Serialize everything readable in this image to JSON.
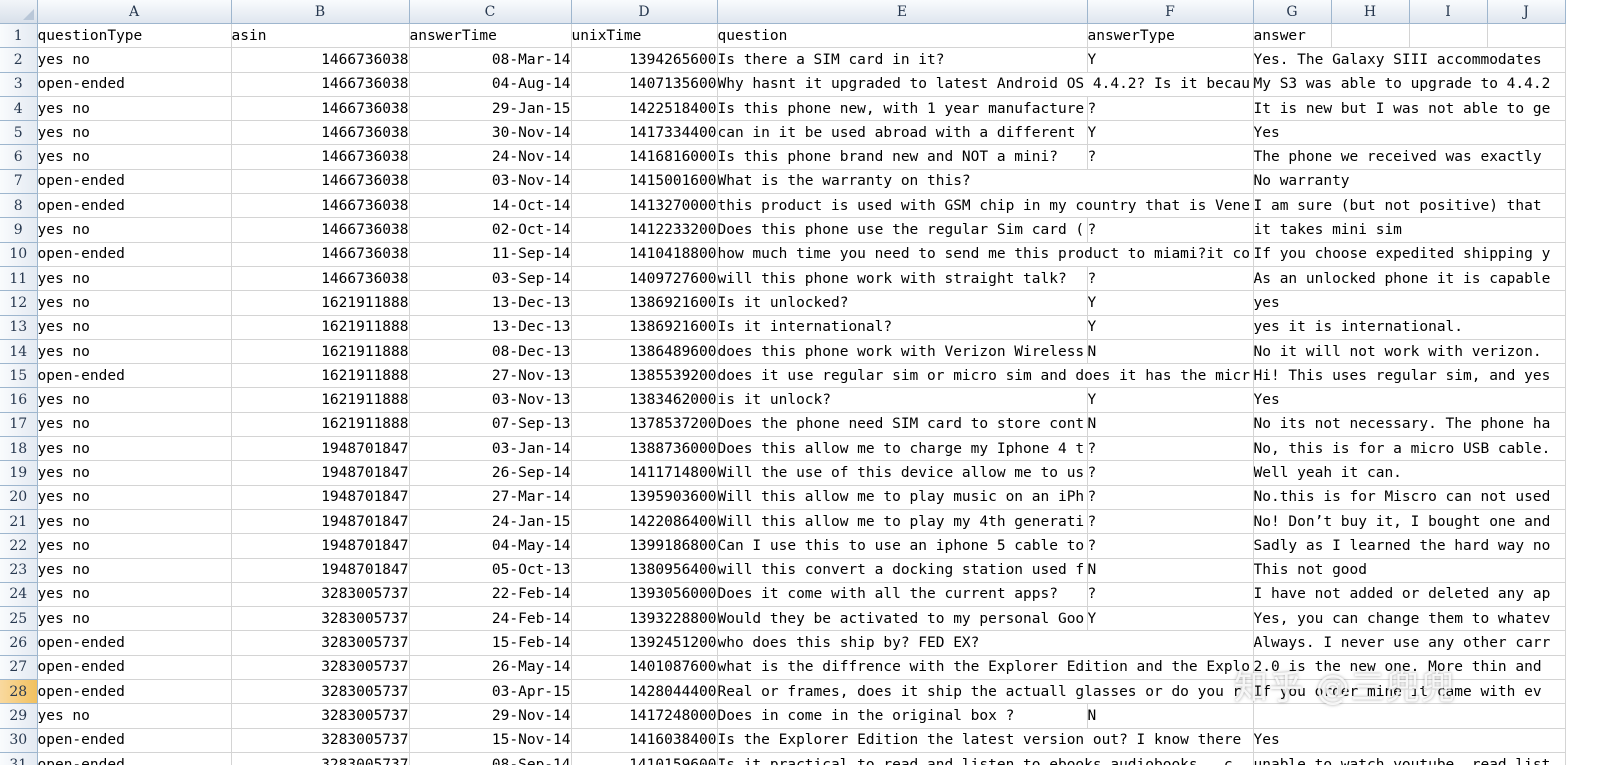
{
  "columns": [
    "A",
    "B",
    "C",
    "D",
    "E",
    "F",
    "G",
    "H",
    "I",
    "J"
  ],
  "header_row": {
    "rownum": "1",
    "cells": [
      "questionType",
      "asin",
      "answerTime",
      "unixTime",
      "question",
      "answerType",
      "answer",
      "",
      "",
      ""
    ]
  },
  "rows": [
    {
      "n": "2",
      "type": "yes no",
      "asin": "1466736038",
      "time": "08-Mar-14",
      "unix": "1394265600",
      "q": "Is there a SIM card in it?",
      "at": "Y",
      "a": "Yes. The Galaxy SIII accommodates"
    },
    {
      "n": "3",
      "type": "open-ended",
      "asin": "1466736038",
      "time": "04-Aug-14",
      "unix": "1407135600",
      "q": "Why hasnt it upgraded to latest Android OS 4.4.2? Is it becau",
      "at": "",
      "a": "My S3 was able to upgrade to 4.4.2"
    },
    {
      "n": "4",
      "type": "yes no",
      "asin": "1466736038",
      "time": "29-Jan-15",
      "unix": "1422518400",
      "q": "Is this phone new, with 1 year manufacture",
      "at": "?",
      "a": "It is new but I was not able to ge"
    },
    {
      "n": "5",
      "type": "yes no",
      "asin": "1466736038",
      "time": "30-Nov-14",
      "unix": "1417334400",
      "q": "can in it be used abroad with a different",
      "at": "Y",
      "a": "Yes"
    },
    {
      "n": "6",
      "type": "yes no",
      "asin": "1466736038",
      "time": "24-Nov-14",
      "unix": "1416816000",
      "q": "Is this phone brand new and NOT a mini?",
      "at": "?",
      "a": "The phone we received was exactly"
    },
    {
      "n": "7",
      "type": "open-ended",
      "asin": "1466736038",
      "time": "03-Nov-14",
      "unix": "1415001600",
      "q": "What is the warranty on this?",
      "at": "",
      "a": "No warranty"
    },
    {
      "n": "8",
      "type": "open-ended",
      "asin": "1466736038",
      "time": "14-Oct-14",
      "unix": "1413270000",
      "q": "this product is used with GSM chip in my country that is Vene",
      "at": "",
      "a": "I am sure (but not positive) that"
    },
    {
      "n": "9",
      "type": "yes no",
      "asin": "1466736038",
      "time": "02-Oct-14",
      "unix": "1412233200",
      "q": "Does this phone use the regular Sim card (",
      "at": "?",
      "a": "it takes mini sim"
    },
    {
      "n": "10",
      "type": "open-ended",
      "asin": "1466736038",
      "time": "11-Sep-14",
      "unix": "1410418800",
      "q": "how much time you need to send me this product to miami?it co",
      "at": "",
      "a": "If you choose expedited shipping y"
    },
    {
      "n": "11",
      "type": "yes no",
      "asin": "1466736038",
      "time": "03-Sep-14",
      "unix": "1409727600",
      "q": "will this phone work with straight talk?",
      "at": "?",
      "a": "As an unlocked phone it is capable"
    },
    {
      "n": "12",
      "type": "yes no",
      "asin": "1621911888",
      "time": "13-Dec-13",
      "unix": "1386921600",
      "q": "Is it unlocked?",
      "at": "Y",
      "a": "yes"
    },
    {
      "n": "13",
      "type": "yes no",
      "asin": "1621911888",
      "time": "13-Dec-13",
      "unix": "1386921600",
      "q": "Is it international?",
      "at": "Y",
      "a": "yes it is international."
    },
    {
      "n": "14",
      "type": "yes no",
      "asin": "1621911888",
      "time": "08-Dec-13",
      "unix": "1386489600",
      "q": "does this phone work with Verizon Wireless",
      "at": "N",
      "a": "No it will not work with verizon."
    },
    {
      "n": "15",
      "type": "open-ended",
      "asin": "1621911888",
      "time": "27-Nov-13",
      "unix": "1385539200",
      "q": "does it use regular sim or micro sim and does it has the micr",
      "at": "",
      "a": "Hi! This uses regular sim, and yes"
    },
    {
      "n": "16",
      "type": "yes no",
      "asin": "1621911888",
      "time": "03-Nov-13",
      "unix": "1383462000",
      "q": "is it unlock?",
      "at": "Y",
      "a": "Yes"
    },
    {
      "n": "17",
      "type": "yes no",
      "asin": "1621911888",
      "time": "07-Sep-13",
      "unix": "1378537200",
      "q": "Does the phone need SIM card to store cont",
      "at": "N",
      "a": "No its not necessary. The phone ha"
    },
    {
      "n": "18",
      "type": "yes no",
      "asin": "1948701847",
      "time": "03-Jan-14",
      "unix": "1388736000",
      "q": "Does this allow me to charge my Iphone 4 t",
      "at": "?",
      "a": "No, this is for a micro USB cable."
    },
    {
      "n": "19",
      "type": "yes no",
      "asin": "1948701847",
      "time": "26-Sep-14",
      "unix": "1411714800",
      "q": "Will the use of this device allow me to us",
      "at": "?",
      "a": "Well yeah it can."
    },
    {
      "n": "20",
      "type": "yes no",
      "asin": "1948701847",
      "time": "27-Mar-14",
      "unix": "1395903600",
      "q": "Will this allow me to play music on an iPh",
      "at": "?",
      "a": "No.this is for Miscro can not used"
    },
    {
      "n": "21",
      "type": "yes no",
      "asin": "1948701847",
      "time": "24-Jan-15",
      "unix": "1422086400",
      "q": "Will this allow me to play my 4th generati",
      "at": "?",
      "a": "No! Don’t buy it, I bought one and"
    },
    {
      "n": "22",
      "type": "yes no",
      "asin": "1948701847",
      "time": "04-May-14",
      "unix": "1399186800",
      "q": "Can I use this to use an iphone 5 cable to",
      "at": "?",
      "a": "Sadly as I learned the hard way no"
    },
    {
      "n": "23",
      "type": "yes no",
      "asin": "1948701847",
      "time": "05-Oct-13",
      "unix": "1380956400",
      "q": "will this convert a docking station used f",
      "at": "N",
      "a": "This not good"
    },
    {
      "n": "24",
      "type": "yes no",
      "asin": "3283005737",
      "time": "22-Feb-14",
      "unix": "1393056000",
      "q": "Does it come with all the current apps?",
      "at": "?",
      "a": "I have not added or deleted any ap"
    },
    {
      "n": "25",
      "type": "yes no",
      "asin": "3283005737",
      "time": "24-Feb-14",
      "unix": "1393228800",
      "q": "Would they be activated to my personal Goo",
      "at": "Y",
      "a": "Yes, you can change them to whatev"
    },
    {
      "n": "26",
      "type": "open-ended",
      "asin": "3283005737",
      "time": "15-Feb-14",
      "unix": "1392451200",
      "q": "who does this ship by? FED EX?",
      "at": "",
      "a": "Always. I never use any other carr"
    },
    {
      "n": "27",
      "type": "open-ended",
      "asin": "3283005737",
      "time": "26-May-14",
      "unix": "1401087600",
      "q": "what is the diffrence with the Explorer Edition and the Explo",
      "at": "",
      "a": "2.0 is the new one. More thin and"
    },
    {
      "n": "28",
      "type": "open-ended",
      "asin": "3283005737",
      "time": "03-Apr-15",
      "unix": "1428044400",
      "q": "Real or frames, does it ship the actuall glasses or do you r",
      "at": "",
      "a": "If you order mine it came with ev"
    },
    {
      "n": "29",
      "type": "yes no",
      "asin": "3283005737",
      "time": "29-Nov-14",
      "unix": "1417248000",
      "q": "Does in come in the original box ?",
      "at": "N",
      "a": ""
    },
    {
      "n": "30",
      "type": "open-ended",
      "asin": "3283005737",
      "time": "15-Nov-14",
      "unix": "1416038400",
      "q": "Is the Explorer Edition the latest version out? I know there",
      "at": "",
      "a": "Yes"
    },
    {
      "n": "31",
      "type": "open-ended",
      "asin": "3283005737",
      "time": "08-Sep-14",
      "unix": "1410159600",
      "q": "Is it practical to read and listen to ebooks  audiobooks , c",
      "at": "",
      "a": "unable to watch youtube, read list"
    }
  ],
  "active_row": "28",
  "watermark": "知乎 @三兜兜",
  "colors": {
    "header_bg": "#dfe6ef",
    "grid": "#d4d4d4",
    "active_row_header": "#f1c15f"
  }
}
